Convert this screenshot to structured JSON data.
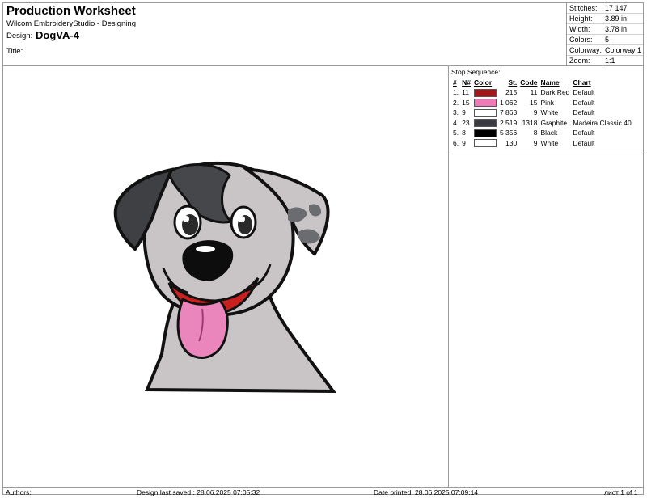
{
  "header": {
    "title": "Production Worksheet",
    "subtitle": "Wilcom EmbroideryStudio - Designing",
    "design_label": "Design:",
    "design_name": "DogVA-4",
    "title_label": "Title:"
  },
  "stats": [
    {
      "key": "Stitches:",
      "value": "17 147"
    },
    {
      "key": "Height:",
      "value": "3.89 in"
    },
    {
      "key": "Width:",
      "value": "3.78 in"
    },
    {
      "key": "Colors:",
      "value": "5"
    },
    {
      "key": "Colorway:",
      "value": "Colorway 1"
    },
    {
      "key": "Zoom:",
      "value": "1:1"
    }
  ],
  "stop_sequence": {
    "title": "Stop Sequence:",
    "columns": [
      "#",
      "N#",
      "Color",
      "St.",
      "Code",
      "Name",
      "Chart"
    ],
    "rows": [
      {
        "idx": "1.",
        "n": "11",
        "color": "#a3161b",
        "st": "215",
        "code": "11",
        "name": "Dark Red",
        "chart": "Default"
      },
      {
        "idx": "2.",
        "n": "15",
        "color": "#f07ab8",
        "st": "1 062",
        "code": "15",
        "name": "Pink",
        "chart": "Default"
      },
      {
        "idx": "3.",
        "n": "9",
        "color": "#ffffff",
        "st": "7 863",
        "code": "9",
        "name": "White",
        "chart": "Default"
      },
      {
        "idx": "4.",
        "n": "23",
        "color": "#3a3b40",
        "st": "2 519",
        "code": "1318",
        "name": "Graphite",
        "chart": "Madeira Classic 40"
      },
      {
        "idx": "5.",
        "n": "8",
        "color": "#000000",
        "st": "5 356",
        "code": "8",
        "name": "Black",
        "chart": "Default"
      },
      {
        "idx": "6.",
        "n": "9",
        "color": "#ffffff",
        "st": "130",
        "code": "9",
        "name": "White",
        "chart": "Default"
      }
    ]
  },
  "footer": {
    "authors": "Authors:",
    "last_saved": "Design last saved : 28.06.2025 07:05:32",
    "printed": "Date printed: 28.06.2025 07:09:14",
    "page": "лист 1 of 1"
  },
  "colors": {
    "fur": "#c9c4c6",
    "patch": "#45474b",
    "tongue": "#ea86bb",
    "mouth": "#c8201e",
    "outline": "#111111"
  }
}
